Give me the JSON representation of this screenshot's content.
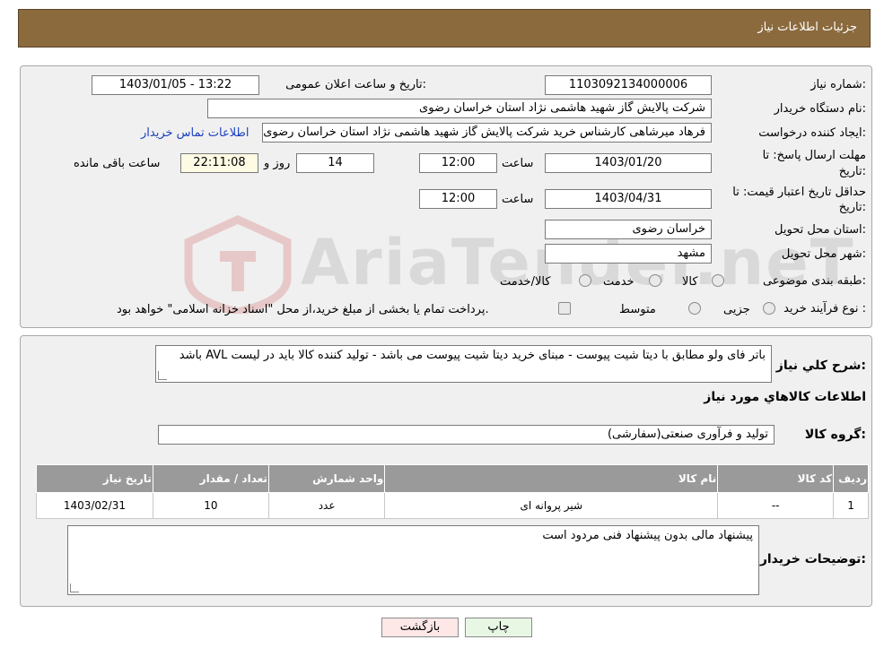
{
  "header": {
    "title": "جزئیات اطلاعات نیاز"
  },
  "labels": {
    "need_number": "شماره نیاز:",
    "announce_datetime": "تاریخ و ساعت اعلان عمومی:",
    "buyer_org": "نام دستگاه خریدار:",
    "requester": "ایجاد کننده درخواست:",
    "reply_deadline_1": "مهلت ارسال پاسخ: تا",
    "reply_deadline_2": "تاریخ:",
    "hour": "ساعت",
    "day_and": "روز و",
    "remaining": "ساعت باقی مانده",
    "price_validity_1": "حداقل تاریخ اعتبار قیمت: تا",
    "price_validity_2": "تاریخ:",
    "delivery_province": "استان محل تحویل:",
    "delivery_city": "شهر محل تحویل:",
    "category": "طبقه بندی موضوعی:",
    "process_type": "نوع فرآیند خرید :",
    "general_desc": "شرح کلي نياز:",
    "goods_info": "اطلاعات کالاهاي مورد نياز",
    "goods_group": "گروه کالا:",
    "buyer_notes": "توضیحات خریدار:"
  },
  "fields": {
    "need_number": "1103092134000006",
    "announce_datetime": "1403/01/05 - 13:22",
    "buyer_org": "شرکت پالایش گاز شهید هاشمی نژاد   استان خراسان رضوی",
    "requester": "فرهاد میرشاهی کارشناس خرید شرکت پالایش گاز شهید هاشمی نژاد   استان خراسان رضوی",
    "contact_link": "اطلاعات تماس خریدار",
    "reply_date": "1403/01/20",
    "reply_time": "12:00",
    "reply_days": "14",
    "remaining_time": "22:11:08",
    "price_date": "1403/04/31",
    "price_time": "12:00",
    "delivery_province": "خراسان رضوی",
    "delivery_city": "مشهد",
    "general_desc": "باتر فای ولو مطابق با دیتا شیت پیوست - مبنای خرید دیتا شیت پیوست می باشد - تولید کننده کالا باید در لیست AVL باشد",
    "goods_group": "تولید و فرآوری صنعتی(سفارشی)",
    "buyer_notes": "پیشنهاد مالی بدون پیشنهاد فنی مردود است"
  },
  "category_options": [
    "کالا",
    "خدمت",
    "کالا/خدمت"
  ],
  "process_options": [
    "جزیی",
    "متوسط"
  ],
  "process_note": "پرداخت تمام یا بخشی از مبلغ خرید،از محل \"اسناد خزانه اسلامی\" خواهد بود.",
  "table": {
    "headers": [
      "ردیف",
      "کد کالا",
      "نام کالا",
      "واحد شمارش",
      "تعداد / مقدار",
      "تاریخ نیاز"
    ],
    "rows": [
      [
        "1",
        "--",
        "شیر پروانه ای",
        "عدد",
        "10",
        "1403/02/31"
      ]
    ]
  },
  "buttons": {
    "print": "چاپ",
    "back": "بازگشت"
  },
  "watermark": "AriaTender.neT",
  "colors": {
    "header_bg": "#8b6a3e",
    "link": "#1a3fbf",
    "back_button_bg": "#fde7e7",
    "print_button_bg": "#e8f7e4"
  }
}
